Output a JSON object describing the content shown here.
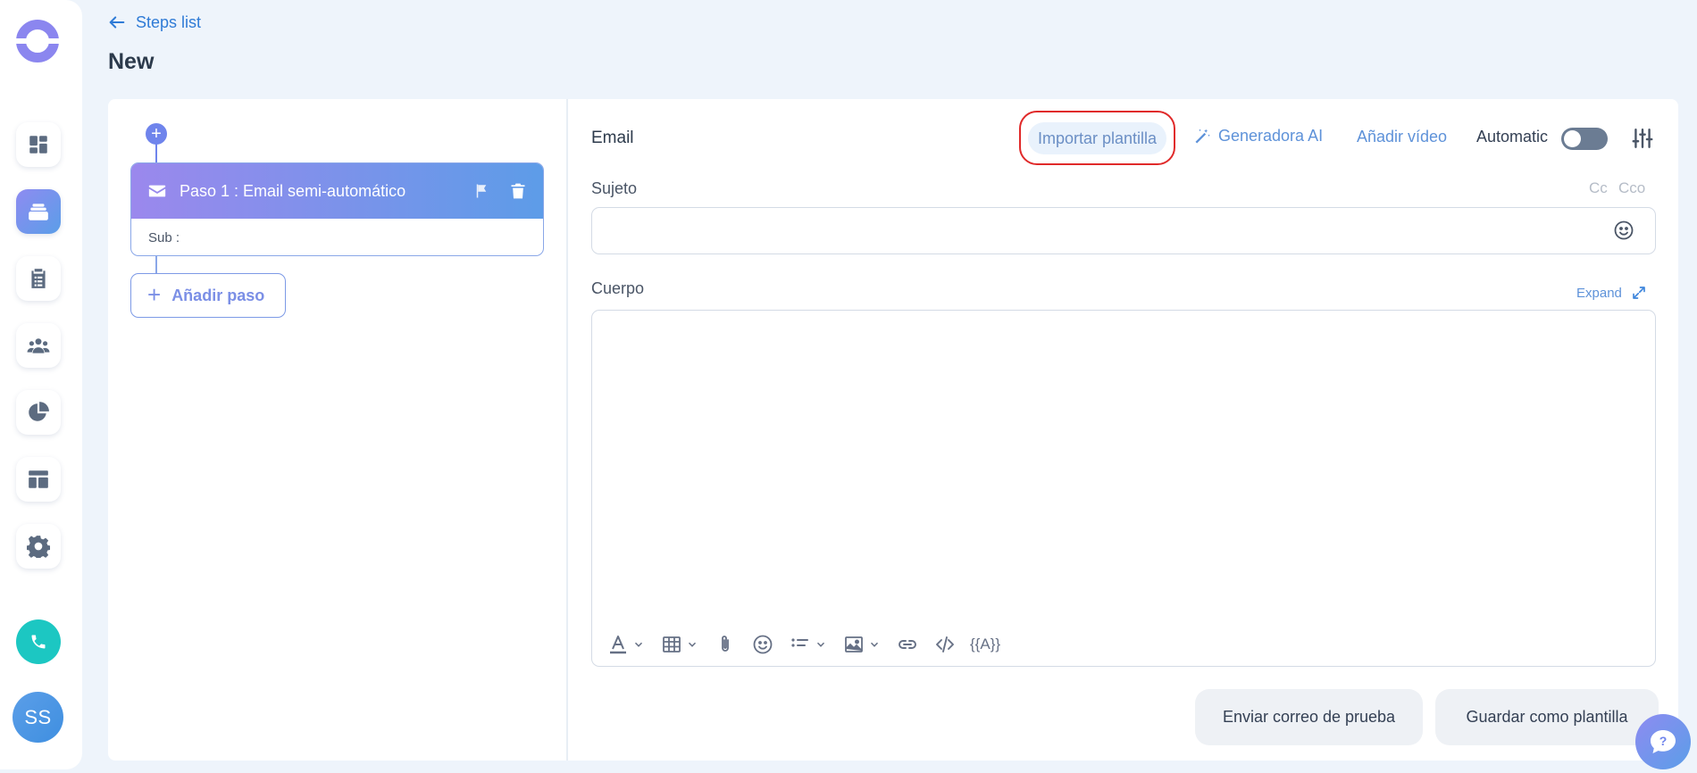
{
  "nav": {
    "back_label": "Steps list",
    "page_title": "New",
    "items": [
      {
        "icon": "dashboard-icon"
      },
      {
        "icon": "campaigns-icon",
        "active": true
      },
      {
        "icon": "tasks-icon"
      },
      {
        "icon": "contacts-icon"
      },
      {
        "icon": "reports-icon"
      },
      {
        "icon": "templates-icon"
      },
      {
        "icon": "gear-icon"
      }
    ],
    "phone_icon": "phone-icon",
    "avatar_initials": "SS"
  },
  "steps": {
    "items": [
      {
        "title": "Paso 1 : Email semi-automático",
        "sub": "Sub :"
      }
    ],
    "add_label": "Añadir paso"
  },
  "email": {
    "label": "Email",
    "import_label": "Importar plantilla",
    "ai_label": "Generadora AI",
    "video_label": "Añadir vídeo",
    "automatic_label": "Automatic",
    "automatic_on": false,
    "subject_label": "Sujeto",
    "subject_value": "",
    "cc_label": "Cc",
    "cco_label": "Cco",
    "body_label": "Cuerpo",
    "expand_label": "Expand",
    "variables_label": "{{A}}",
    "send_test_label": "Enviar correo de prueba",
    "save_template_label": "Guardar como plantilla"
  },
  "colors": {
    "accent": "#8e8bf1",
    "link": "#2f7bd6",
    "highlight_ring": "#e02a2a"
  }
}
